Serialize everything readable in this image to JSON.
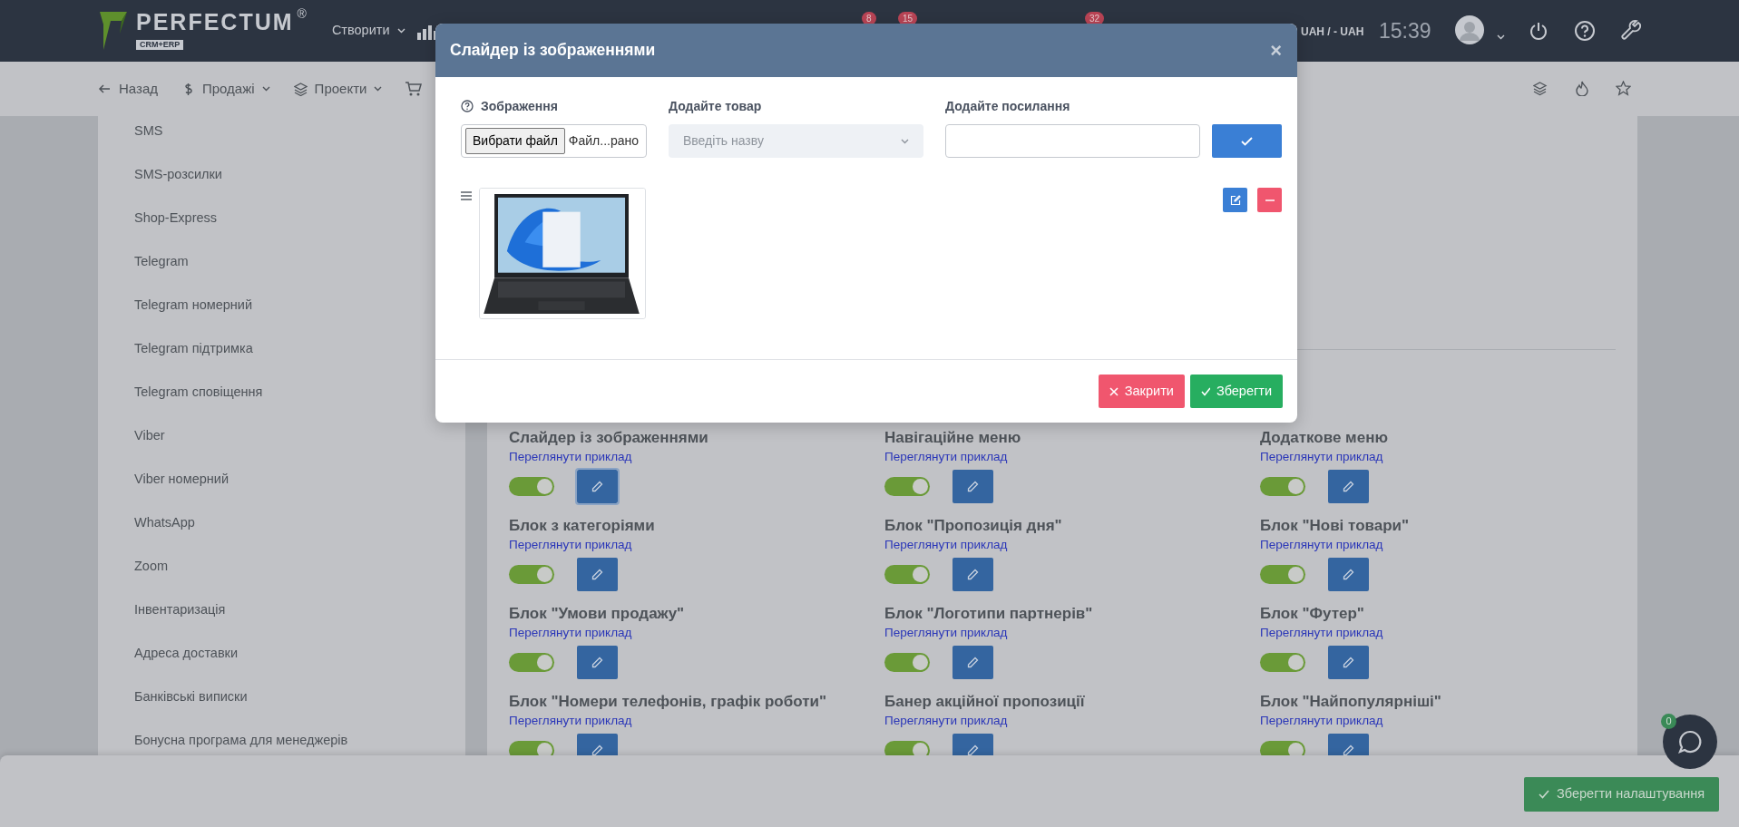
{
  "topbar": {
    "logo": {
      "name": "PERFECTUM",
      "mark": "®",
      "tagline": "CRM+ERP"
    },
    "create_menu": "Створити",
    "badges": [
      "8",
      "15",
      "32"
    ],
    "currency": "UAH / - UAH",
    "time": "15:39"
  },
  "toolbar": {
    "items": [
      {
        "label": "Назад",
        "kind": "back"
      },
      {
        "label": "Продажі",
        "kind": "money"
      },
      {
        "label": "Проекти",
        "kind": "layers"
      }
    ]
  },
  "sidebar": {
    "items": [
      "SMS",
      "SMS-розсилки",
      "Shop-Express",
      "Telegram",
      "Telegram номерний",
      "Telegram підтримка",
      "Telegram сповіщення",
      "Viber",
      "Viber номерний",
      "WhatsApp",
      "Zoom",
      "Інвентаризація",
      "Адреса доставки",
      "Банківські виписки",
      "Бонусна програма для менеджерів"
    ]
  },
  "blocks": [
    {
      "title": "Слайдер із зображеннями",
      "link": "Переглянути приклад",
      "on": true
    },
    {
      "title": "Навігаційне меню",
      "link": "Переглянути приклад",
      "on": true
    },
    {
      "title": "Додаткове меню",
      "link": "Переглянути приклад",
      "on": true
    },
    {
      "title": "Блок з категоріями",
      "link": "Переглянути приклад",
      "on": true
    },
    {
      "title": "Блок \"Пропозиція дня\"",
      "link": "Переглянути приклад",
      "on": true
    },
    {
      "title": "Блок \"Нові товари\"",
      "link": "Переглянути приклад",
      "on": true
    },
    {
      "title": "Блок \"Умови продажу\"",
      "link": "Переглянути приклад",
      "on": true
    },
    {
      "title": "Блок \"Логотипи партнерів\"",
      "link": "Переглянути приклад",
      "on": true
    },
    {
      "title": "Блок \"Футер\"",
      "link": "Переглянути приклад",
      "on": true
    },
    {
      "title": "Блок \"Номери телефонів, графік роботи\"",
      "link": "Переглянути приклад",
      "on": true
    },
    {
      "title": "Банер акційної пропозиції",
      "link": "Переглянути приклад",
      "on": true
    },
    {
      "title": "Блок \"Найпопулярніші\"",
      "link": "Переглянути приклад",
      "on": true
    }
  ],
  "modal": {
    "title": "Слайдер із зображеннями",
    "close": "×",
    "image_label": "Зображення",
    "file_button": "Вибрати файл",
    "file_name": "Файл...рано",
    "product_label": "Додайте товар",
    "product_placeholder": "Введіть назву",
    "link_label": "Додайте посилання",
    "buttons": [
      {
        "label": "Закрити",
        "kind": "cancel"
      },
      {
        "label": "Зберегти",
        "kind": "save"
      }
    ]
  },
  "save_settings": "Зберегти налаштування",
  "chat": {
    "badge": "0"
  }
}
